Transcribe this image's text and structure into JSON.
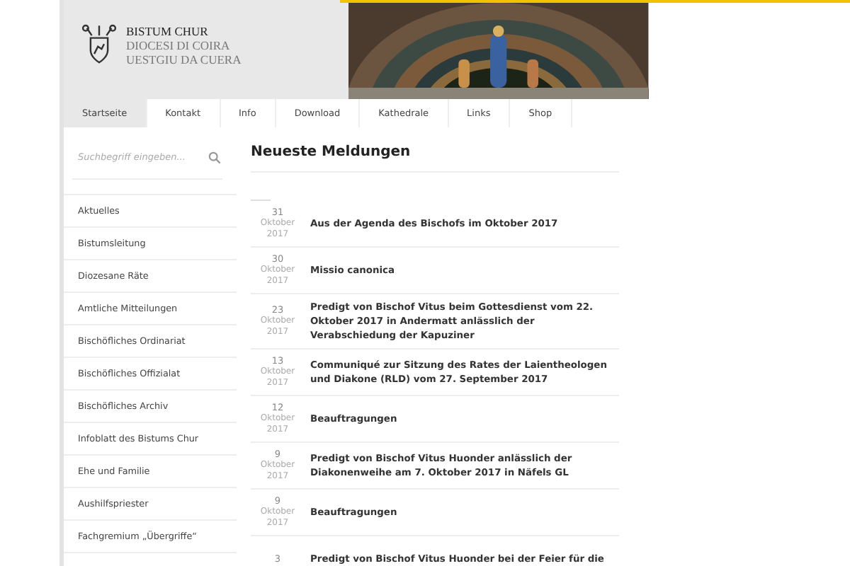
{
  "header": {
    "logo_lines": [
      "BISTUM CHUR",
      "DIOCESI DI COIRA",
      "UESTGIU DA CUERA"
    ]
  },
  "tabs": [
    {
      "label": "Startseite",
      "selected": true
    },
    {
      "label": "Kontakt",
      "selected": false
    },
    {
      "label": "Info",
      "selected": false
    },
    {
      "label": "Download",
      "selected": false
    },
    {
      "label": "Kathedrale",
      "selected": false
    },
    {
      "label": "Links",
      "selected": false
    },
    {
      "label": "Shop",
      "selected": false
    }
  ],
  "search": {
    "placeholder": "Suchbegriff eingeben..."
  },
  "sidebar": {
    "items": [
      "Aktuelles",
      "Bistumsleitung",
      "Diozesane Räte",
      "Amtliche Mitteilungen",
      "Bischöfliches Ordinariat",
      "Bischöfliches Offizialat",
      "Bischöfliches Archiv",
      "Infoblatt des Bistums Chur",
      "Ehe und Familie",
      "Aushilfspriester",
      "Fachgremium „Übergriffe“"
    ]
  },
  "news": {
    "title": "Neueste Meldungen",
    "items": [
      {
        "day": "31",
        "month": "Oktober",
        "year": "2017",
        "title": "Aus der Agenda des Bischofs im Oktober 2017"
      },
      {
        "day": "30",
        "month": "Oktober",
        "year": "2017",
        "title": "Missio canonica"
      },
      {
        "day": "23",
        "month": "Oktober",
        "year": "2017",
        "title": "Predigt von Bischof Vitus beim Gottesdienst vom 22. Oktober 2017 in Andermatt anlässlich der Verabschiedung der Kapuziner"
      },
      {
        "day": "13",
        "month": "Oktober",
        "year": "2017",
        "title": "Communiqué zur Sitzung des Rates der Laientheologen und Diakone (RLD) vom 27. September 2017"
      },
      {
        "day": "12",
        "month": "Oktober",
        "year": "2017",
        "title": "Beauftragungen"
      },
      {
        "day": "9",
        "month": "Oktober",
        "year": "2017",
        "title": "Predigt von Bischof Vitus Huonder anlässlich der Diakonenweihe am 7. Oktober 2017 in Näfels GL"
      },
      {
        "day": "9",
        "month": "Oktober",
        "year": "2017",
        "title": "Beauftragungen"
      },
      {
        "day": "3",
        "title": "Predigt von Bischof Vitus Huonder bei der Feier für die"
      }
    ]
  }
}
